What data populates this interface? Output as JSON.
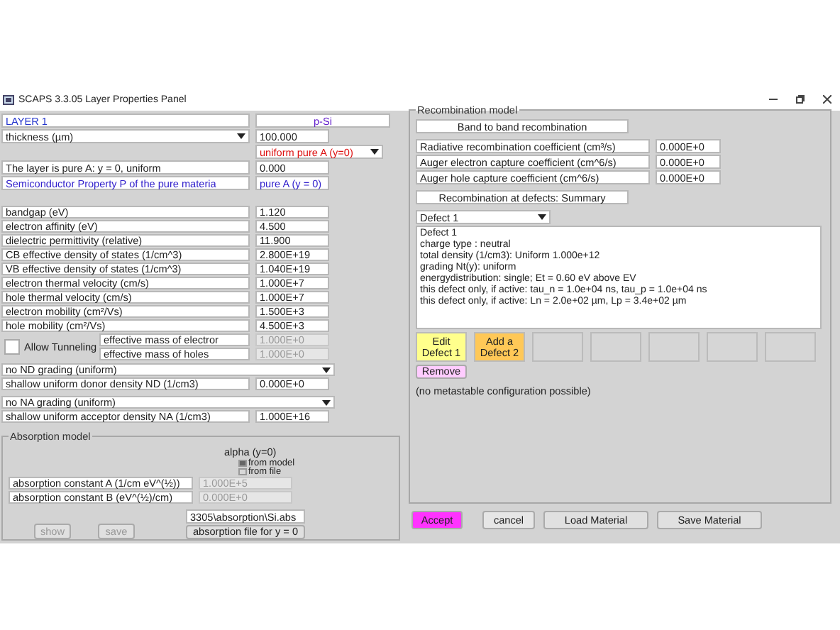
{
  "window": {
    "title": "SCAPS 3.3.05 Layer Properties Panel"
  },
  "layer": {
    "label": "LAYER 1",
    "name": "p-Si"
  },
  "thickness": {
    "label": "thickness (µm)",
    "value": "100.000"
  },
  "grading": {
    "value": "uniform pure A (y=0)"
  },
  "composition": {
    "label": "The layer is pure A: y = 0, uniform",
    "value": "0.000"
  },
  "property": {
    "label": "Semiconductor Property P of the pure materia",
    "value": "pure A (y = 0)"
  },
  "properties": [
    {
      "label": "bandgap (eV)",
      "value": "1.120"
    },
    {
      "label": "electron affinity (eV)",
      "value": "4.500"
    },
    {
      "label": "dielectric permittivity (relative)",
      "value": "11.900"
    },
    {
      "label": "CB effective density of states (1/cm^3)",
      "value": "2.800E+19"
    },
    {
      "label": "VB effective density of states (1/cm^3)",
      "value": "1.040E+19"
    },
    {
      "label": "electron thermal velocity (cm/s)",
      "value": "1.000E+7"
    },
    {
      "label": "hole thermal velocity (cm/s)",
      "value": "1.000E+7"
    },
    {
      "label": "electron mobility (cm²/Vs)",
      "value": "1.500E+3"
    },
    {
      "label": "hole mobility (cm²/Vs)",
      "value": "4.500E+3"
    }
  ],
  "tunneling": {
    "label": "Allow Tunneling",
    "checked": false,
    "masses": [
      {
        "label": "effective mass of electror",
        "value": "1.000E+0",
        "disabled": true
      },
      {
        "label": "effective mass of holes",
        "value": "1.000E+0",
        "disabled": true
      }
    ]
  },
  "doping": [
    {
      "grading": "no ND grading (uniform)",
      "label": "shallow uniform donor density ND (1/cm3)",
      "value": "0.000E+0"
    },
    {
      "grading": "no NA grading (uniform)",
      "label": "shallow uniform acceptor density NA (1/cm3)",
      "value": "1.000E+16"
    }
  ],
  "absorption": {
    "title": "Absorption model",
    "alpha_label": "alpha (y=0)",
    "sources": [
      {
        "label": "from model",
        "selected": true
      },
      {
        "label": "from file",
        "selected": false
      }
    ],
    "constants": [
      {
        "label": "absorption constant A (1/cm eV^(½))",
        "value": "1.000E+5",
        "disabled": true
      },
      {
        "label": "absorption constant B (eV^(½)/cm)",
        "value": "0.000E+0",
        "disabled": true
      }
    ],
    "file": "3305\\absorption\\Si.abs",
    "file_button": "absorption file for y = 0",
    "buttons": [
      {
        "label": "show",
        "disabled": true
      },
      {
        "label": "save",
        "disabled": true
      }
    ]
  },
  "recombination": {
    "title": "Recombination model",
    "band_header": "Band to band recombination",
    "coefficients": [
      {
        "label": "Radiative recombination coefficient (cm³/s)",
        "value": "0.000E+0"
      },
      {
        "label": "Auger electron capture coefficient (cm^6/s)",
        "value": "0.000E+0"
      },
      {
        "label": "Auger hole capture coefficient (cm^6/s)",
        "value": "0.000E+0"
      }
    ],
    "defects_header": "Recombination at defects: Summary",
    "defect_select": "Defect 1",
    "summary": [
      "Defect 1",
      "charge type : neutral",
      "total density (1/cm3): Uniform   1.000e+12",
      "grading Nt(y): uniform",
      "energydistribution: single; Et = 0.60 eV above EV",
      "this defect only, if active: tau_n =  1.0e+04 ns, tau_p =  1.0e+04 ns",
      "this defect only, if active: Ln =  2.0e+02 µm, Lp =  3.4e+02 µm"
    ],
    "slots": [
      {
        "kind": "edit",
        "label": "Edit\nDefect 1",
        "color": "#ffff8c"
      },
      {
        "kind": "add",
        "label": "Add a\nDefect 2",
        "color": "#ffc857"
      },
      {
        "kind": "empty"
      },
      {
        "kind": "empty"
      },
      {
        "kind": "empty"
      },
      {
        "kind": "empty"
      },
      {
        "kind": "empty"
      }
    ],
    "remove": "Remove",
    "note": "(no metastable configuration possible)"
  },
  "actions": [
    {
      "kind": "accept",
      "label": "Accept"
    },
    {
      "kind": "cancel",
      "label": "cancel"
    },
    {
      "kind": "wide",
      "label": "Load Material"
    },
    {
      "kind": "wide",
      "label": "Save Material"
    }
  ]
}
